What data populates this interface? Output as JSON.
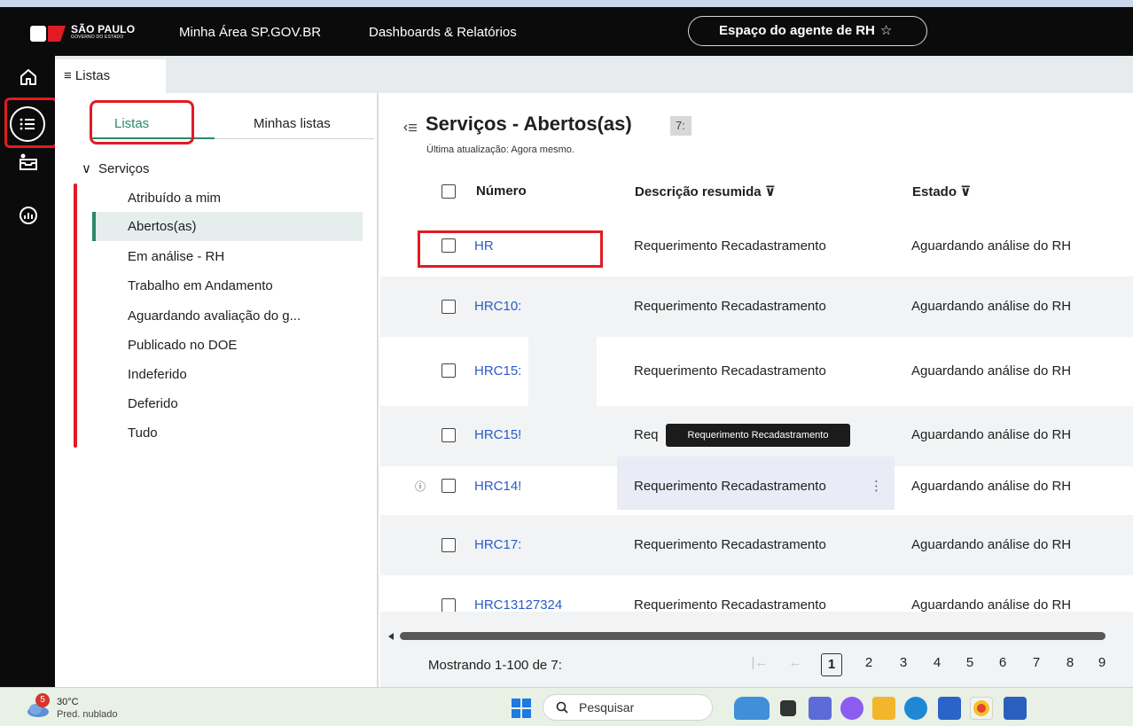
{
  "header": {
    "logo_main": "SÃO PAULO",
    "logo_sub": "GOVERNO DO ESTADO",
    "nav": [
      "Minha Área SP.GOV.BR",
      "Dashboards & Relatórios"
    ],
    "agent_button": "Espaço do agente de RH",
    "agent_star": "☆"
  },
  "tabstrip": {
    "tab_label": "≡ Listas"
  },
  "panel": {
    "tabs": [
      "Listas",
      "Minhas listas"
    ],
    "tree_head": "Serviços",
    "tree_chevron": "∨",
    "items": [
      "Atribuído a mim",
      "Abertos(as)",
      "Em análise - RH",
      "Trabalho em Andamento",
      "Aguardando avaliação do g...",
      "Publicado no DOE",
      "Indeferido",
      "Deferido",
      "Tudo"
    ],
    "selected_index": 1
  },
  "main": {
    "title": "Serviços - Abertos(as)",
    "count": "7:",
    "subtitle": "Última atualização: Agora mesmo.",
    "columns": {
      "number": "Número",
      "description": "Descrição resumida ⊽",
      "state": "Estado ⊽"
    },
    "rows": [
      {
        "number": "HR",
        "description": "Requerimento Recadastramento",
        "state": "Aguardando análise do RH"
      },
      {
        "number": "HRC10:",
        "description": "Requerimento Recadastramento",
        "state": "Aguardando análise do RH"
      },
      {
        "number": "HRC15:",
        "description": "Requerimento Recadastramento",
        "state": "Aguardando análise do RH"
      },
      {
        "number": "HRC15!",
        "description": "Req",
        "description_tail": "o",
        "state": "Aguardando análise do RH"
      },
      {
        "number": "HRC14!",
        "description": "Requerimento Recadastramento",
        "state": "Aguardando análise do RH"
      },
      {
        "number": "HRC17:",
        "description": "Requerimento Recadastramento",
        "state": "Aguardando análise do RH"
      },
      {
        "number": "HRC13127324",
        "description": "Requerimento Recadastramento",
        "state": "Aguardando análise do RH"
      }
    ],
    "tooltip": "Requerimento Recadastramento",
    "more_icon": "⋮",
    "info_icon": "ⓘ",
    "footer": "Mostrando 1-100 de 7:",
    "pages": [
      "1",
      "2",
      "3",
      "4",
      "5",
      "6",
      "7",
      "8",
      "9"
    ],
    "current_page": "1",
    "first_page_icon": "|←",
    "prev_page_icon": "←"
  },
  "taskbar": {
    "weather_temp": "30°C",
    "weather_desc": "Pred. nublado",
    "weather_badge": "5",
    "search_placeholder": "Pesquisar"
  },
  "colors": {
    "accent_green": "#2b8a68",
    "link_blue": "#2a5bc7",
    "annotation_red": "#e11b22"
  }
}
